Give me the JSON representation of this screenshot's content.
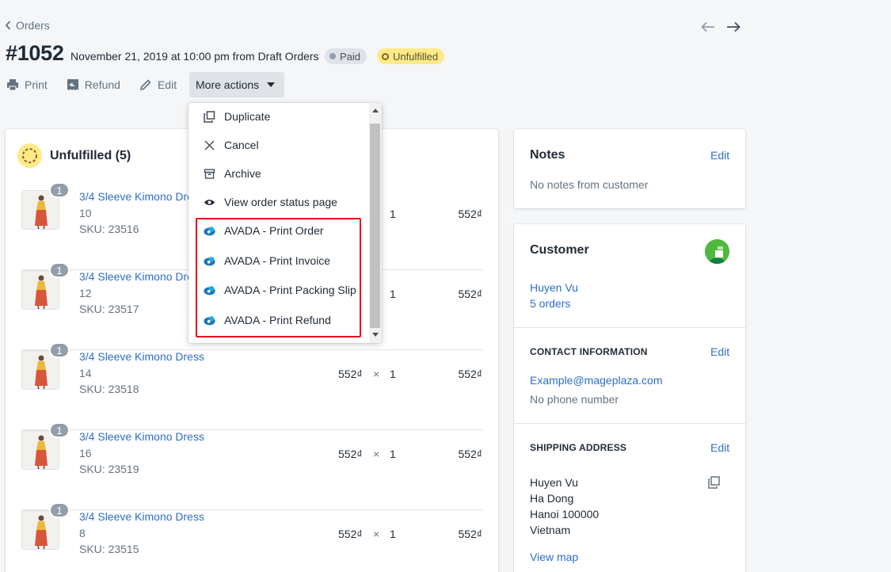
{
  "breadcrumb": {
    "label": "Orders"
  },
  "order": {
    "number": "#1052",
    "subtitle": "November 21, 2019 at 10:00 pm from Draft Orders",
    "payment_status": "Paid",
    "fulfillment_status": "Unfulfilled"
  },
  "toolbar": {
    "print": "Print",
    "refund": "Refund",
    "edit": "Edit",
    "more": "More actions"
  },
  "dropdown": {
    "items": [
      "Duplicate",
      "Cancel",
      "Archive",
      "View order status page"
    ],
    "avada": [
      "AVADA - Print Order",
      "AVADA - Print Invoice",
      "AVADA - Print Packing Slip",
      "AVADA - Print Refund"
    ]
  },
  "fulfillment": {
    "title": "Unfulfilled (5)",
    "items": [
      {
        "qty_badge": "1",
        "name": "3/4 Sleeve Kimono Dress",
        "variant": "10",
        "sku": "SKU: 23516",
        "price": "",
        "times": "",
        "qty": "1",
        "total": "552₫"
      },
      {
        "qty_badge": "1",
        "name": "3/4 Sleeve Kimono Dress",
        "variant": "12",
        "sku": "SKU: 23517",
        "price": "",
        "times": "",
        "qty": "1",
        "total": "552₫"
      },
      {
        "qty_badge": "1",
        "name": "3/4 Sleeve Kimono Dress",
        "variant": "14",
        "sku": "SKU: 23518",
        "price": "552₫",
        "times": "×",
        "qty": "1",
        "total": "552₫"
      },
      {
        "qty_badge": "1",
        "name": "3/4 Sleeve Kimono Dress",
        "variant": "16",
        "sku": "SKU: 23519",
        "price": "552₫",
        "times": "×",
        "qty": "1",
        "total": "552₫"
      },
      {
        "qty_badge": "1",
        "name": "3/4 Sleeve Kimono Dress",
        "variant": "8",
        "sku": "SKU: 23515",
        "price": "552₫",
        "times": "×",
        "qty": "1",
        "total": "552₫"
      }
    ]
  },
  "notes": {
    "title": "Notes",
    "edit": "Edit",
    "text": "No notes from customer"
  },
  "customer": {
    "title": "Customer",
    "name": "Huyen Vu",
    "orders": "5 orders",
    "contact_title": "CONTACT INFORMATION",
    "contact_edit": "Edit",
    "email": "Example@mageplaza.com",
    "phone": "No phone number",
    "shipping_title": "SHIPPING ADDRESS",
    "shipping_edit": "Edit",
    "address": [
      "Huyen Vu",
      "Ha Dong",
      "Hanoi 100000",
      "Vietnam"
    ],
    "view_map": "View map"
  },
  "colors": {
    "accent": "#2c6ecb",
    "unfulfilled_badge": "#ffea8a",
    "highlight": "#e3131b"
  }
}
